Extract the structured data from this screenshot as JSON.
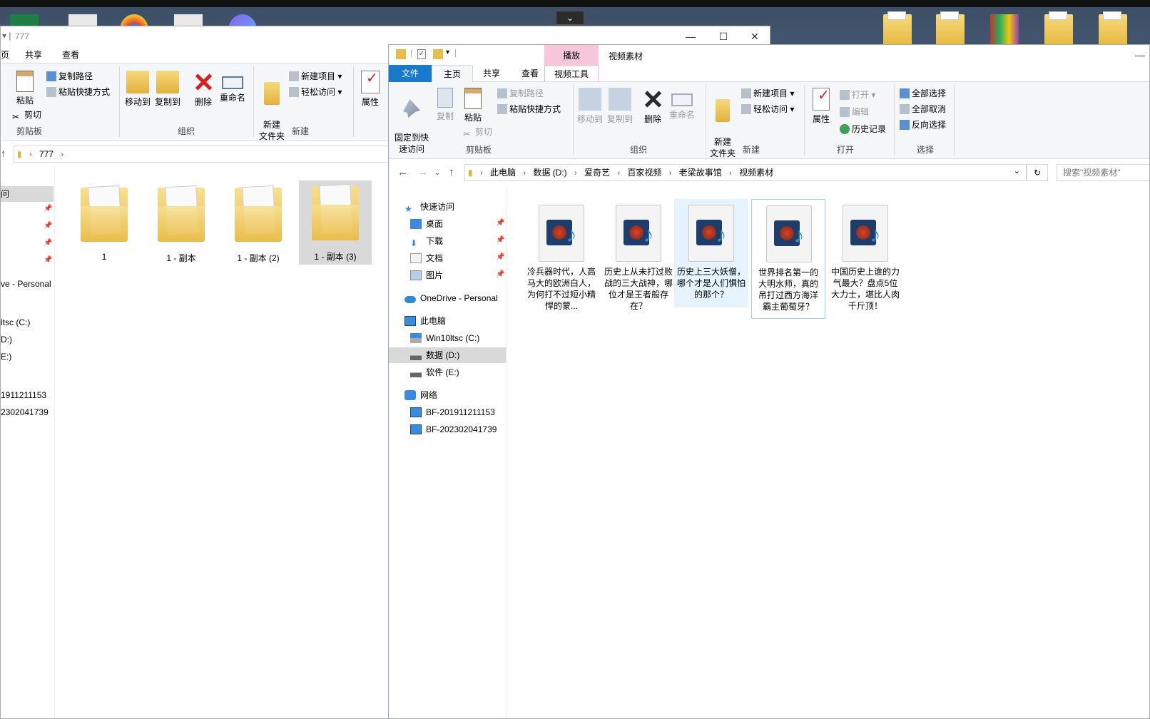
{
  "left_window": {
    "title": "777",
    "tabs": [
      "页",
      "共享",
      "查看"
    ],
    "clipboard": {
      "paste": "粘贴",
      "copy_path": "复制路径",
      "paste_shortcut": "粘贴快捷方式",
      "cut": "剪切",
      "group": "剪贴板"
    },
    "organize": {
      "move_to": "移动到",
      "copy_to": "复制到",
      "delete": "删除",
      "rename": "重命名",
      "group": "组织"
    },
    "new": {
      "new_folder": "新建\n文件夹",
      "new_item": "新建项目",
      "easy_access": "轻松访问",
      "group": "新建"
    },
    "open": {
      "properties": "属性"
    },
    "breadcrumb": [
      "777"
    ],
    "nav_items": [
      "问",
      "ve - Personal",
      "ltsc (C:)",
      "D:)",
      "E:)",
      "1911211153",
      "2302041739"
    ],
    "folders": [
      "1",
      "1 - 副本",
      "1 - 副本 (2)",
      "1 - 副本 (3)"
    ]
  },
  "right_window": {
    "title": "视频素材",
    "context_tab": "播放",
    "context_tab_color": "#f7c6d9",
    "tabs": {
      "file": "文件",
      "home": "主页",
      "share": "共享",
      "view": "查看",
      "video_tools": "视频工具"
    },
    "clipboard": {
      "pin": "固定到快\n速访问",
      "copy": "复制",
      "paste": "粘贴",
      "copy_path": "复制路径",
      "paste_shortcut": "粘贴快捷方式",
      "cut": "剪切",
      "group": "剪贴板"
    },
    "organize": {
      "move_to": "移动到",
      "copy_to": "复制到",
      "delete": "删除",
      "rename": "重命名",
      "group": "组织"
    },
    "new": {
      "new_folder": "新建\n文件夹",
      "new_item": "新建项目",
      "easy_access": "轻松访问",
      "group": "新建"
    },
    "open": {
      "properties": "属性",
      "open": "打开",
      "edit": "编辑",
      "history": "历史记录",
      "group": "打开"
    },
    "select": {
      "select_all": "全部选择",
      "select_none": "全部取消",
      "invert": "反向选择",
      "group": "选择"
    },
    "breadcrumb": [
      "此电脑",
      "数据 (D:)",
      "爱奇艺",
      "百家视频",
      "老梁故事馆",
      "视频素材"
    ],
    "search_placeholder": "搜索\"视频素材\"",
    "nav": {
      "quick_access": "快速访问",
      "desktop": "桌面",
      "downloads": "下载",
      "documents": "文档",
      "pictures": "图片",
      "onedrive": "OneDrive - Personal",
      "this_pc": "此电脑",
      "c_drive": "Win10ltsc (C:)",
      "d_drive": "数据 (D:)",
      "e_drive": "软件 (E:)",
      "network": "网络",
      "pc1": "BF-201911211153",
      "pc2": "BF-202302041739"
    },
    "files": [
      "冷兵器时代，人高马大的欧洲白人，为何打不过短小精悍的蒙...",
      "历史上从未打过败战的三大战神，哪位才是王者般存在？",
      "历史上三大妖僧，哪个才是人们惧怕的那个？",
      "世界排名第一的大明水师，真的吊打过西方海洋霸主葡萄牙？",
      "中国历史上谁的力气最大？盘点5位大力士，堪比人肉千斤顶！"
    ]
  },
  "colors": {
    "accent_blue": "#1979ca",
    "selection": "#cce8ff",
    "folder": "#e9bd4a"
  }
}
